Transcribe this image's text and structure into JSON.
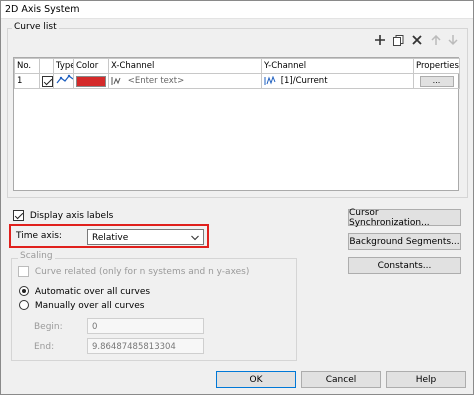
{
  "window": {
    "title": "2D Axis System"
  },
  "curve_list": {
    "group_label": "Curve list",
    "toolbar": {
      "add_icon": "plus-icon",
      "copy_icon": "copy-icon",
      "delete_icon": "delete-x-icon",
      "up_icon": "arrow-up-icon",
      "down_icon": "arrow-down-icon"
    },
    "columns": [
      "No.",
      "Type",
      "Color",
      "X-Channel",
      "Y-Channel",
      "Properties"
    ],
    "rows": [
      {
        "no": "1",
        "checked": true,
        "color": "#d42a2a",
        "x_channel": "<Enter text>",
        "y_channel": "[1]/Current",
        "properties_btn": "..."
      }
    ]
  },
  "display_axis_labels": {
    "label": "Display axis labels",
    "checked": true
  },
  "time_axis": {
    "label": "Time axis:",
    "value": "Relative"
  },
  "scaling": {
    "group_label": "Scaling",
    "curve_related": "Curve related (only for n systems and n y-axes)",
    "automatic": "Automatic over all curves",
    "manual": "Manually over all curves",
    "selected": "automatic",
    "begin_label": "Begin:",
    "begin_value": "0",
    "end_label": "End:",
    "end_value": "9.86487485813304"
  },
  "side_buttons": {
    "cursor_sync": "Cursor Synchronization...",
    "background_segments": "Background Segments...",
    "constants": "Constants..."
  },
  "footer": {
    "ok": "OK",
    "cancel": "Cancel",
    "help": "Help"
  },
  "colors": {
    "highlight": "#e0201c",
    "accent": "#0078d7"
  }
}
